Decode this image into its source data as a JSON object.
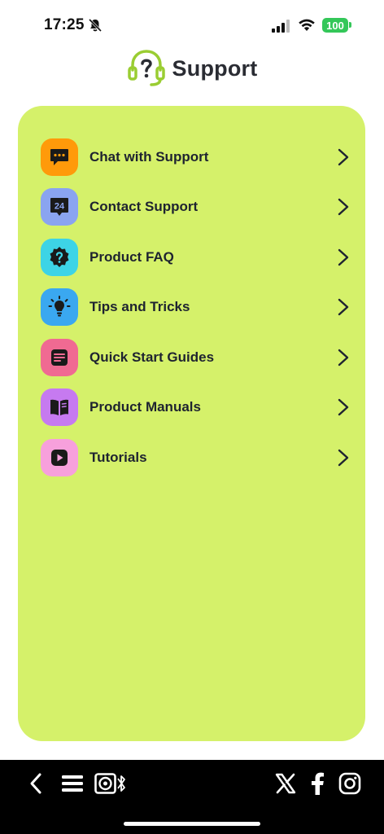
{
  "status_bar": {
    "time": "17:25",
    "battery": "100",
    "icons": [
      "bell-muted-icon",
      "signal-icon",
      "wifi-icon",
      "battery-icon"
    ]
  },
  "header": {
    "title": "Support",
    "logo_icon": "headset-question-icon"
  },
  "colors": {
    "card_background": "#d5f16a",
    "logo_green": "#9acd32",
    "toolbar_background": "#000000"
  },
  "menu": {
    "items": [
      {
        "label": "Chat with Support",
        "icon": "chat-bubble-icon",
        "icon_bg": "#ff9a0a"
      },
      {
        "label": "Contact Support",
        "icon": "support-24-icon",
        "icon_bg": "#8aa4f0"
      },
      {
        "label": "Product FAQ",
        "icon": "faq-question-icon",
        "icon_bg": "#3dd4e6"
      },
      {
        "label": "Tips and Tricks",
        "icon": "lightbulb-icon",
        "icon_bg": "#3aa8f0"
      },
      {
        "label": "Quick Start Guides",
        "icon": "guide-icon",
        "icon_bg": "#f06a92"
      },
      {
        "label": "Product Manuals",
        "icon": "book-icon",
        "icon_bg": "#c67af0"
      },
      {
        "label": "Tutorials",
        "icon": "play-icon",
        "icon_bg": "#f7a0dc"
      }
    ]
  },
  "toolbar": {
    "left": [
      "back-icon",
      "menu-icon",
      "speaker-bluetooth-icon"
    ],
    "right": [
      "x-logo-icon",
      "facebook-icon",
      "instagram-icon"
    ]
  }
}
